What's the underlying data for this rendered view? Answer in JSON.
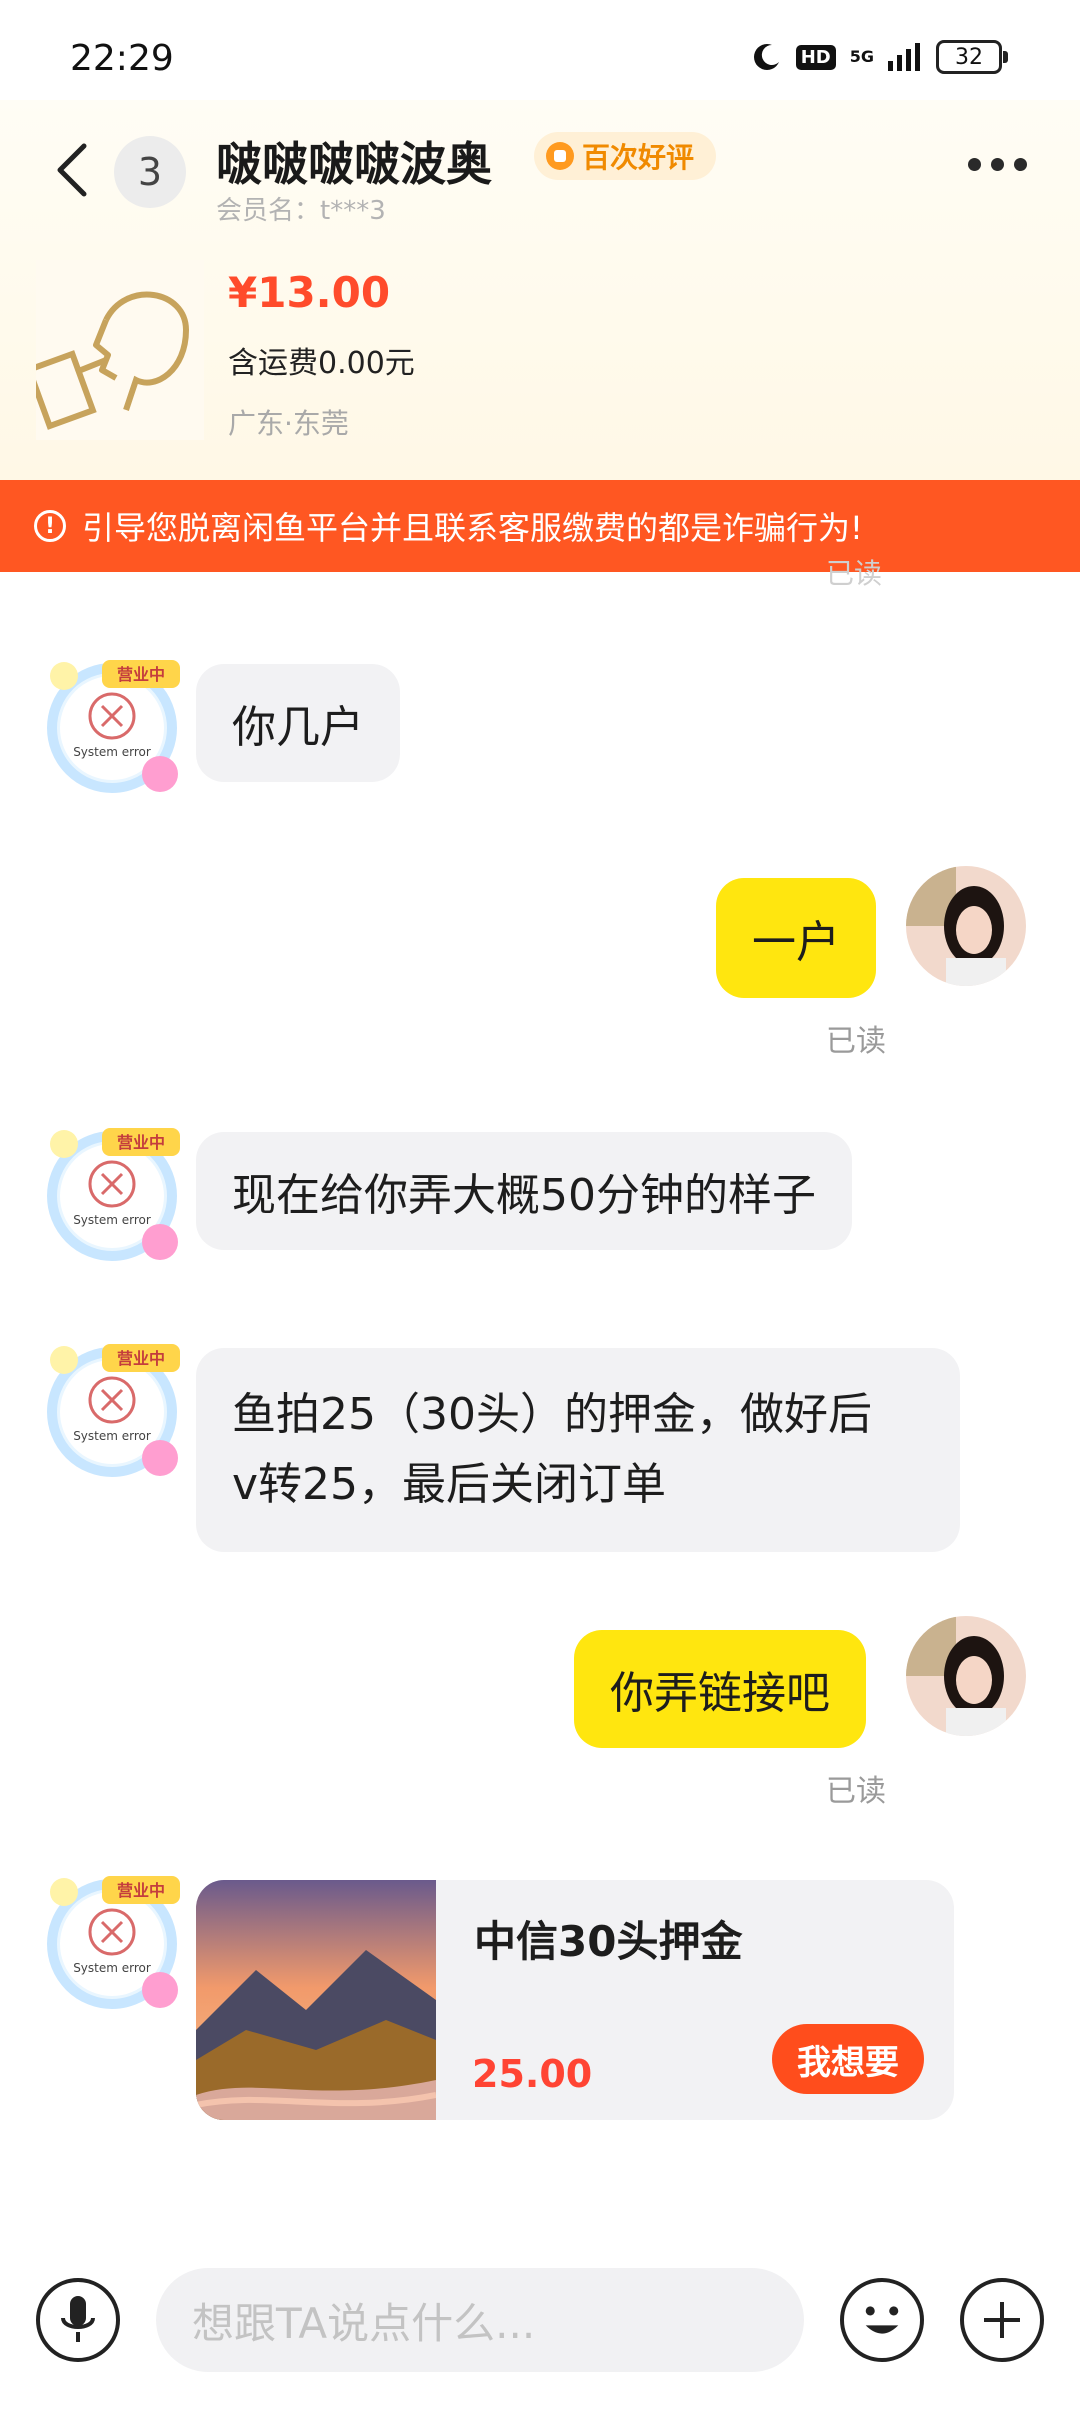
{
  "status_bar": {
    "time": "22:29",
    "hd": "HD",
    "network": "5G",
    "battery": "32",
    "icons": [
      "moon-icon",
      "signal-icon"
    ]
  },
  "header": {
    "unread_count": "3",
    "seller_name": "啵啵啵啵波奥",
    "rating_badge": "百次好评",
    "member_name": "会员名：t***3",
    "icons": [
      "back-arrow-icon",
      "more-dots-icon"
    ]
  },
  "product": {
    "price": "¥13.00",
    "shipping": "含运费0.00元",
    "location": "广东·东莞"
  },
  "warning": {
    "text": "引导您脱离闲鱼平台并且联系客服缴费的都是诈骗行为!"
  },
  "messages": [
    {
      "side": "left",
      "text": "你几户"
    },
    {
      "side": "right",
      "text": "一户",
      "status": "已读"
    },
    {
      "side": "left",
      "text": "现在给你弄大概50分钟的样子"
    },
    {
      "side": "left",
      "lines": [
        "鱼拍25（30头）的押金，做好后",
        "v转25，最后关闭订单"
      ]
    },
    {
      "side": "right",
      "text": "你弄链接吧",
      "status": "已读"
    }
  ],
  "faint_status": "已读",
  "avatar_left": {
    "badge": "营业中",
    "error_text": "System error"
  },
  "card": {
    "title": "中信30头押金",
    "price": "25.00",
    "button": "我想要"
  },
  "input": {
    "placeholder": "想跟TA说点什么..."
  },
  "colors": {
    "accent_yellow": "#ffe60f",
    "warning_orange": "#ff5722",
    "price_red": "#ff4b2b",
    "button_orange": "#ff4d1c"
  }
}
